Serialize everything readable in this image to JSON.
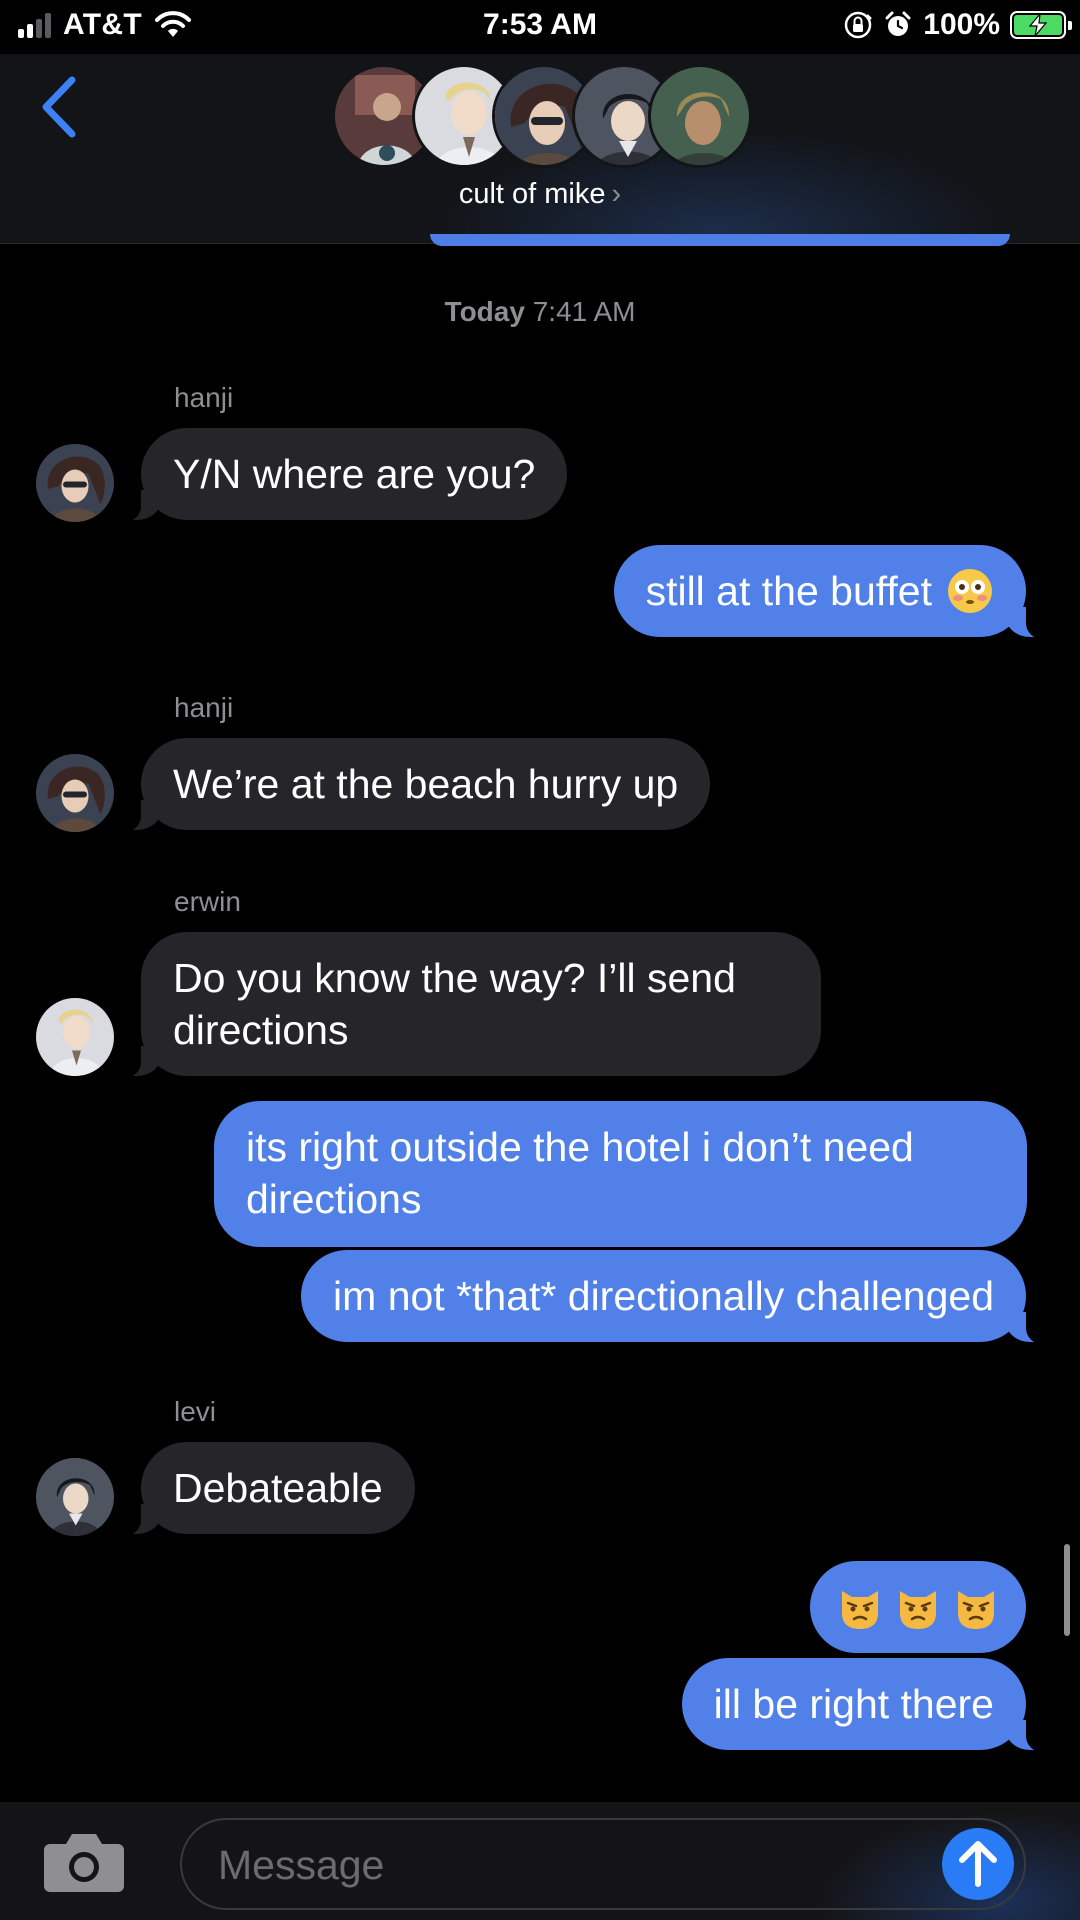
{
  "status_bar": {
    "carrier": "AT&T",
    "time": "7:53 AM",
    "battery_percent": "100%",
    "signal_bars": 2,
    "icons": [
      "cellular-signal-icon",
      "wifi-icon",
      "orientation-lock-icon",
      "alarm-icon",
      "battery-charging-icon"
    ]
  },
  "header": {
    "group_name": "cult of mike",
    "chevron": "›",
    "participants": [
      "mike",
      "erwin",
      "hanji",
      "levi",
      "moblit"
    ]
  },
  "conversation": {
    "timestamp_day": "Today",
    "timestamp_time": "7:41 AM",
    "messages": [
      {
        "sender": "hanji",
        "text": "Y/N where are you?"
      },
      {
        "sender": "me",
        "text": "still at the buffet",
        "emoji": "flushed-face"
      },
      {
        "sender": "hanji",
        "text": "We’re at the beach hurry up"
      },
      {
        "sender": "erwin",
        "text_lines": [
          "Do you know the way? I’ll send",
          "directions"
        ]
      },
      {
        "sender": "me",
        "text_lines": [
          "its right outside the hotel i don’t need",
          "directions"
        ]
      },
      {
        "sender": "me",
        "text": "im not *that* directionally challenged"
      },
      {
        "sender": "levi",
        "text": "Debateable"
      },
      {
        "sender": "me",
        "emoji": "pouting-cat x3"
      },
      {
        "sender": "me",
        "text": "ill be right there"
      }
    ]
  },
  "input_bar": {
    "placeholder": "Message",
    "camera_icon": "camera-icon",
    "send_icon": "arrow-up-icon"
  },
  "colors": {
    "background": "#000000",
    "incoming_bubble": "#26252a",
    "outgoing_bubble": "#5080e8",
    "accent_blue": "#2a7cf6",
    "secondary_text": "#8e8e93"
  }
}
